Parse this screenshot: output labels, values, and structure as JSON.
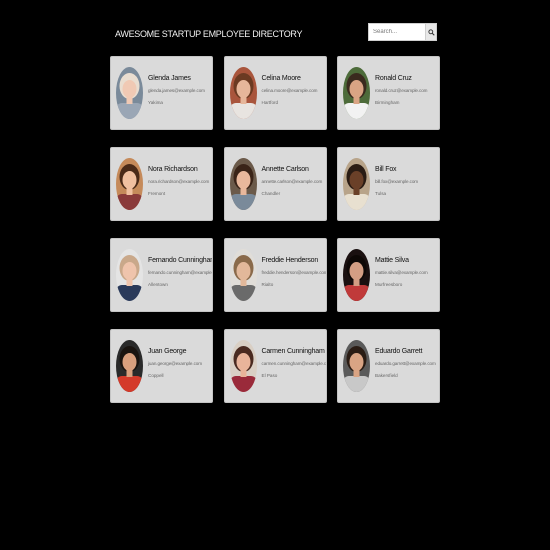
{
  "header": {
    "title": "AWESOME STARTUP EMPLOYEE DIRECTORY"
  },
  "search": {
    "placeholder": "Search...",
    "icon": "search-icon"
  },
  "employees": [
    {
      "name": "Glenda James",
      "email": "glenda.james@example.com",
      "city": "Yakima",
      "photo": {
        "bg": "#7a8a9a",
        "hair": "#e9ddd0",
        "skin": "#f0c9b4",
        "shirt": "#9aa6b5"
      }
    },
    {
      "name": "Celina Moore",
      "email": "celina.moore@example.com",
      "city": "Hartford",
      "photo": {
        "bg": "#a9553c",
        "hair": "#6b3a22",
        "skin": "#e6b69a",
        "shirt": "#e8e4e0"
      }
    },
    {
      "name": "Ronald Cruz",
      "email": "ronald.cruz@example.com",
      "city": "Birmingham",
      "photo": {
        "bg": "#4d6b3a",
        "hair": "#3a2a1e",
        "skin": "#d9a484",
        "shirt": "#f2f2f2"
      }
    },
    {
      "name": "Nora Richardson",
      "email": "nora.richardson@example.com",
      "city": "Fremont",
      "photo": {
        "bg": "#c58a5a",
        "hair": "#4a2a18",
        "skin": "#f0c0a0",
        "shirt": "#8a3a3a"
      }
    },
    {
      "name": "Annette Carlson",
      "email": "annette.carlson@example.com",
      "city": "Chandler",
      "photo": {
        "bg": "#6b5a4a",
        "hair": "#3a2418",
        "skin": "#e9b89c",
        "shirt": "#7a8a9a"
      }
    },
    {
      "name": "Bill Fox",
      "email": "bill.fox@example.com",
      "city": "Tulsa",
      "photo": {
        "bg": "#b8a48a",
        "hair": "#2a1c14",
        "skin": "#6a4028",
        "shirt": "#e8e0d0"
      }
    },
    {
      "name": "Fernando Cunningham",
      "email": "fernando.cunningham@example.com",
      "city": "Allentown",
      "photo": {
        "bg": "#e4e4e4",
        "hair": "#c9a88a",
        "skin": "#efc4ac",
        "shirt": "#2a3a5a"
      }
    },
    {
      "name": "Freddie Henderson",
      "email": "freddie.henderson@example.com",
      "city": "Rialto",
      "photo": {
        "bg": "#e0ddd8",
        "hair": "#8a6a4a",
        "skin": "#e2b89a",
        "shirt": "#6a6a6a"
      }
    },
    {
      "name": "Mattie Silva",
      "email": "mattie.silva@example.com",
      "city": "Murfreesboro",
      "photo": {
        "bg": "#1a1010",
        "hair": "#0e0806",
        "skin": "#d49e84",
        "shirt": "#c03a3a"
      }
    },
    {
      "name": "Juan George",
      "email": "juan.george@example.com",
      "city": "Coppell",
      "photo": {
        "bg": "#2a2a2a",
        "hair": "#1a1410",
        "skin": "#d9a07e",
        "shirt": "#d43a2a"
      }
    },
    {
      "name": "Carmen Cunningham",
      "email": "carmen.cunningham@example.com",
      "city": "El Paso",
      "photo": {
        "bg": "#d9cfc4",
        "hair": "#4a2a20",
        "skin": "#e9b49a",
        "shirt": "#9a2a3a"
      }
    },
    {
      "name": "Eduardo Garrett",
      "email": "eduardo.garrett@example.com",
      "city": "Bakersfield",
      "photo": {
        "bg": "#5a5a5a",
        "hair": "#2a1c14",
        "skin": "#d9a484",
        "shirt": "#c8c8c8"
      }
    }
  ]
}
